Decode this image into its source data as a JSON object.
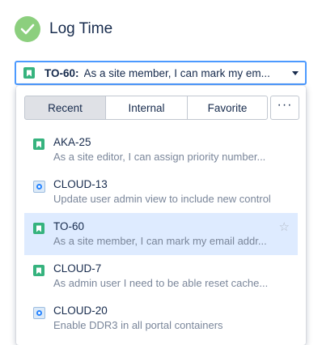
{
  "header": {
    "title": "Log Time",
    "icon": "check-circle-icon",
    "icon_color": "#8ccf7e"
  },
  "select": {
    "key": "TO-60:",
    "summary": "As a site member, I can mark my em...",
    "icon": "story-icon",
    "border_color": "#4c9aff"
  },
  "tabs": [
    {
      "label": "Recent",
      "active": true
    },
    {
      "label": "Internal",
      "active": false
    },
    {
      "label": "Favorite",
      "active": false
    }
  ],
  "more_label": "···",
  "items": [
    {
      "key": "AKA-25",
      "summary": "As a site editor, I can assign priority number...",
      "icon": "story-icon",
      "selected": false
    },
    {
      "key": "CLOUD-13",
      "summary": "Update user admin view to include new control",
      "icon": "task-gear-icon",
      "selected": false
    },
    {
      "key": "TO-60",
      "summary": "As a site member, I can mark my email addr...",
      "icon": "story-icon",
      "selected": true,
      "star": "☆"
    },
    {
      "key": "CLOUD-7",
      "summary": "As admin user I need to be able reset cache...",
      "icon": "story-icon",
      "selected": false
    },
    {
      "key": "CLOUD-20",
      "summary": "Enable DDR3 in all portal containers",
      "icon": "task-gear-icon",
      "selected": false
    }
  ],
  "colors": {
    "story": "#36b37e",
    "selected_row": "#deebff",
    "active_tab": "#dfe1e6"
  }
}
